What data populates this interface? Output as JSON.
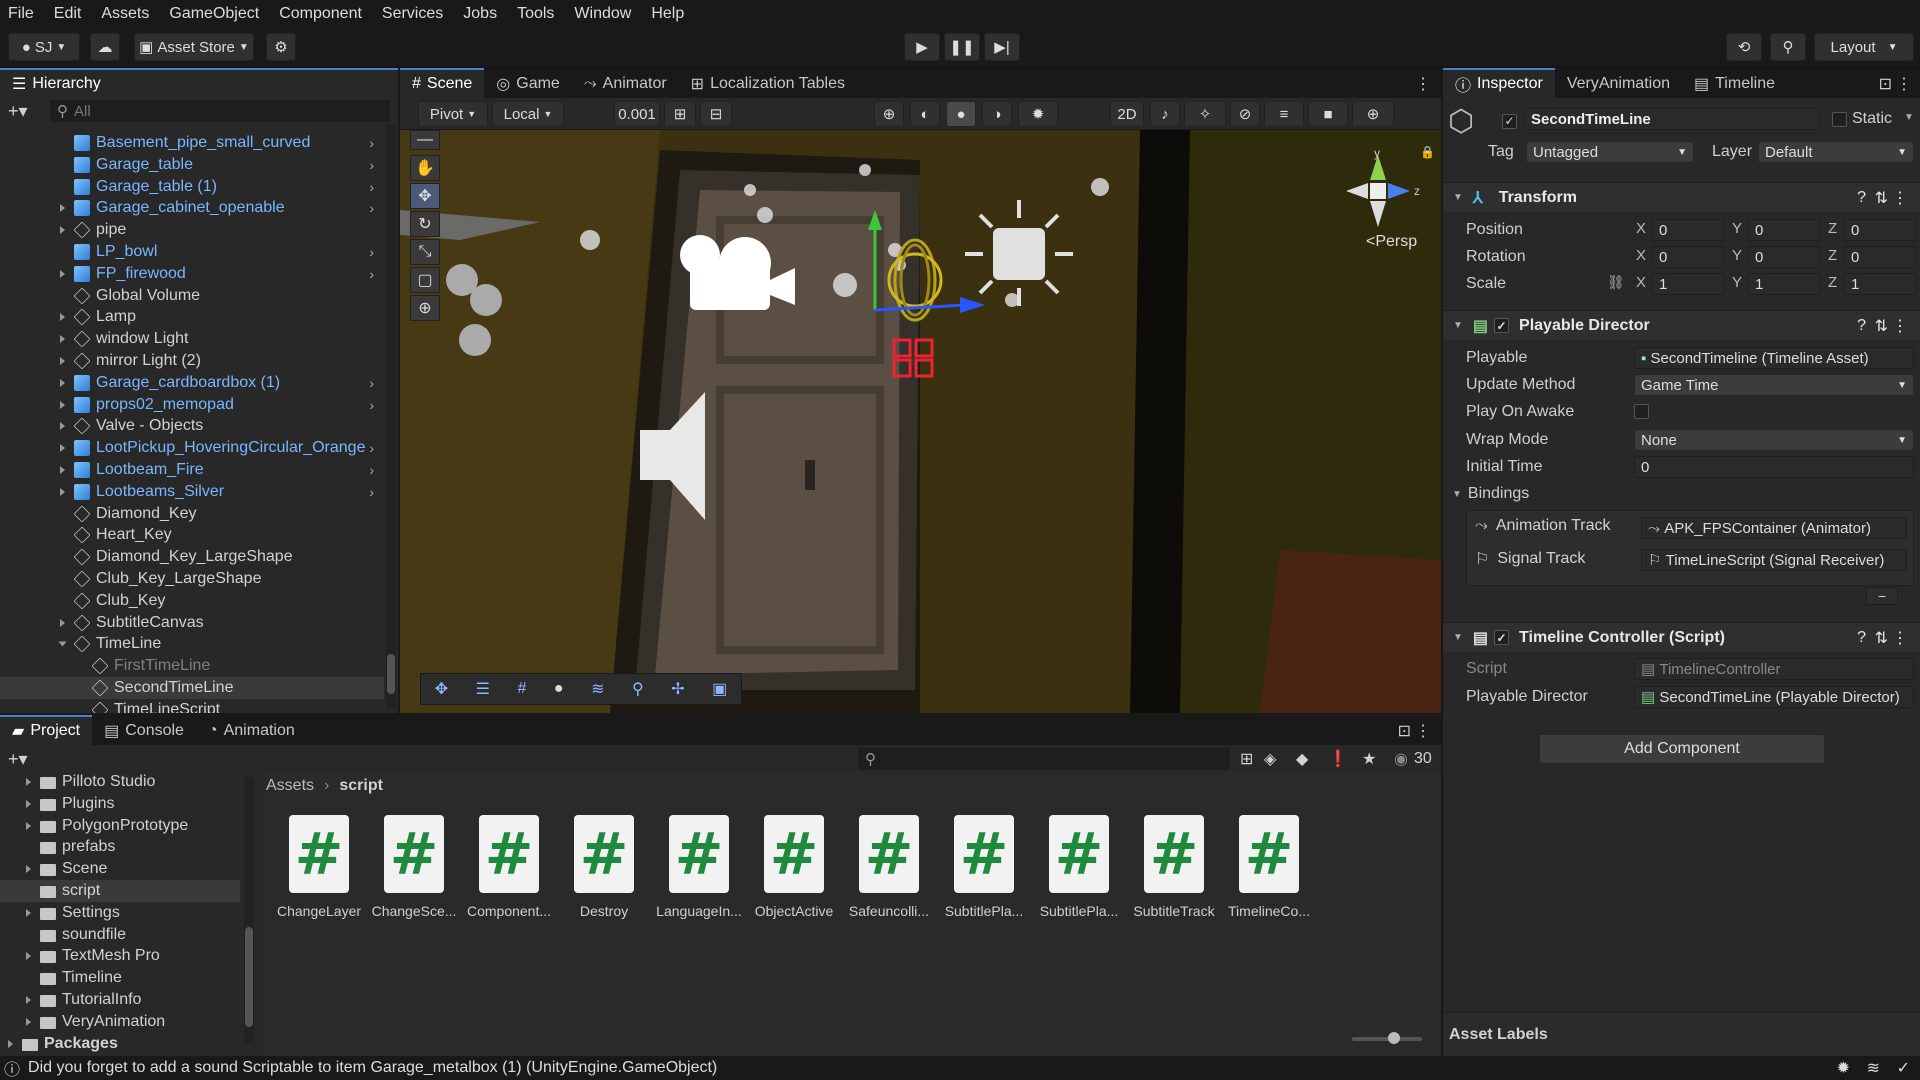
{
  "menu": [
    "File",
    "Edit",
    "Assets",
    "GameObject",
    "Component",
    "Services",
    "Jobs",
    "Tools",
    "Window",
    "Help"
  ],
  "toolbar": {
    "account": "SJ",
    "asset_store": "Asset Store",
    "layout": "Layout"
  },
  "hierarchy": {
    "tab": "Hierarchy",
    "search_placeholder": "All",
    "items": [
      {
        "label": "Basement_pipe_small_curved",
        "prefab": true,
        "arrow": false,
        "child": false
      },
      {
        "label": "Garage_table",
        "prefab": true,
        "arrow": false,
        "child": false
      },
      {
        "label": "Garage_table (1)",
        "prefab": true,
        "arrow": false,
        "child": false
      },
      {
        "label": "Garage_cabinet_openable",
        "prefab": true,
        "arrow": true,
        "child": false
      },
      {
        "label": "pipe",
        "prefab": false,
        "arrow": true,
        "child": false
      },
      {
        "label": "LP_bowl",
        "prefab": true,
        "arrow": false,
        "child": false
      },
      {
        "label": "FP_firewood",
        "prefab": true,
        "arrow": true,
        "child": false
      },
      {
        "label": "Global Volume",
        "prefab": false,
        "arrow": false,
        "child": false
      },
      {
        "label": "Lamp",
        "prefab": false,
        "arrow": true,
        "child": false
      },
      {
        "label": "window Light",
        "prefab": false,
        "arrow": true,
        "child": false
      },
      {
        "label": "mirror Light (2)",
        "prefab": false,
        "arrow": true,
        "child": false
      },
      {
        "label": "Garage_cardboardbox (1)",
        "prefab": true,
        "arrow": true,
        "child": false
      },
      {
        "label": "props02_memopad",
        "prefab": true,
        "arrow": true,
        "child": false
      },
      {
        "label": "Valve - Objects",
        "prefab": false,
        "arrow": true,
        "child": false
      },
      {
        "label": "LootPickup_HoveringCircular_Orange",
        "prefab": true,
        "arrow": true,
        "child": false
      },
      {
        "label": "Lootbeam_Fire",
        "prefab": true,
        "arrow": true,
        "child": false
      },
      {
        "label": "Lootbeams_Silver",
        "prefab": true,
        "arrow": true,
        "child": false
      },
      {
        "label": "Diamond_Key",
        "prefab": false,
        "arrow": false,
        "child": false
      },
      {
        "label": "Heart_Key",
        "prefab": false,
        "arrow": false,
        "child": false
      },
      {
        "label": "Diamond_Key_LargeShape",
        "prefab": false,
        "arrow": false,
        "child": false
      },
      {
        "label": "Club_Key_LargeShape",
        "prefab": false,
        "arrow": false,
        "child": false
      },
      {
        "label": "Club_Key",
        "prefab": false,
        "arrow": false,
        "child": false
      },
      {
        "label": "SubtitleCanvas",
        "prefab": false,
        "arrow": true,
        "child": false
      },
      {
        "label": "TimeLine",
        "prefab": false,
        "arrow": true,
        "child": false,
        "expanded": true
      },
      {
        "label": "FirstTimeLine",
        "prefab": false,
        "arrow": false,
        "child": true,
        "dim": true
      },
      {
        "label": "SecondTimeLine",
        "prefab": false,
        "arrow": false,
        "child": true,
        "selected": true
      },
      {
        "label": "TimeLineScript",
        "prefab": false,
        "arrow": false,
        "child": true
      }
    ]
  },
  "scene_tabs": [
    "Scene",
    "Game",
    "Animator",
    "Localization Tables"
  ],
  "scene_toolbar": {
    "pivot": "Pivot",
    "local": "Local",
    "snap": "0.001",
    "mode2d": "2D"
  },
  "scene": {
    "persp": "<Persp"
  },
  "inspector": {
    "tabs": [
      "Inspector",
      "VeryAnimation",
      "Timeline"
    ],
    "object_name": "SecondTimeLine",
    "static": "Static",
    "tag_label": "Tag",
    "tag": "Untagged",
    "layer_label": "Layer",
    "layer": "Default",
    "transform": {
      "title": "Transform",
      "rows": [
        {
          "label": "Position",
          "x": "0",
          "y": "0",
          "z": "0"
        },
        {
          "label": "Rotation",
          "x": "0",
          "y": "0",
          "z": "0"
        },
        {
          "label": "Scale",
          "x": "1",
          "y": "1",
          "z": "1"
        }
      ]
    },
    "director": {
      "title": "Playable Director",
      "playable_label": "Playable",
      "playable": "SecondTimeline (Timeline Asset)",
      "update_label": "Update Method",
      "update": "Game Time",
      "awake_label": "Play On Awake",
      "wrap_label": "Wrap Mode",
      "wrap": "None",
      "initial_label": "Initial Time",
      "initial": "0",
      "bindings_label": "Bindings",
      "bindings": [
        {
          "track": "Animation Track",
          "value": "APK_FPSContainer (Animator)"
        },
        {
          "track": "Signal Track",
          "value": "TimeLineScript (Signal Receiver)"
        }
      ]
    },
    "controller": {
      "title": "Timeline Controller (Script)",
      "script_label": "Script",
      "script": "TimelineController",
      "director_label": "Playable Director",
      "director": "SecondTimeLine (Playable Director)"
    },
    "add_component": "Add Component",
    "asset_labels": "Asset Labels"
  },
  "project": {
    "tabs": [
      "Project",
      "Console",
      "Animation"
    ],
    "count": "30",
    "breadcrumb": [
      "Assets",
      "script"
    ],
    "folders": [
      {
        "label": "Pilloto Studio",
        "arrow": true
      },
      {
        "label": "Plugins",
        "arrow": true
      },
      {
        "label": "PolygonPrototype",
        "arrow": true
      },
      {
        "label": "prefabs",
        "arrow": false
      },
      {
        "label": "Scene",
        "arrow": true
      },
      {
        "label": "script",
        "arrow": false,
        "selected": true
      },
      {
        "label": "Settings",
        "arrow": true
      },
      {
        "label": "soundfile",
        "arrow": false
      },
      {
        "label": "TextMesh Pro",
        "arrow": true
      },
      {
        "label": "Timeline",
        "arrow": false
      },
      {
        "label": "TutorialInfo",
        "arrow": true
      },
      {
        "label": "VeryAnimation",
        "arrow": true
      },
      {
        "label": "Packages",
        "arrow": true,
        "bold": true
      }
    ],
    "assets": [
      "ChangeLayer",
      "ChangeSce...",
      "Component...",
      "Destroy",
      "LanguageIn...",
      "ObjectActive",
      "Safeuncolli...",
      "SubtitlePla...",
      "SubtitlePla...",
      "SubtitleTrack",
      "TimelineCo..."
    ]
  },
  "status": "Did you forget to add a sound Scriptable to item Garage_metalbox (1) (UnityEngine.GameObject)"
}
